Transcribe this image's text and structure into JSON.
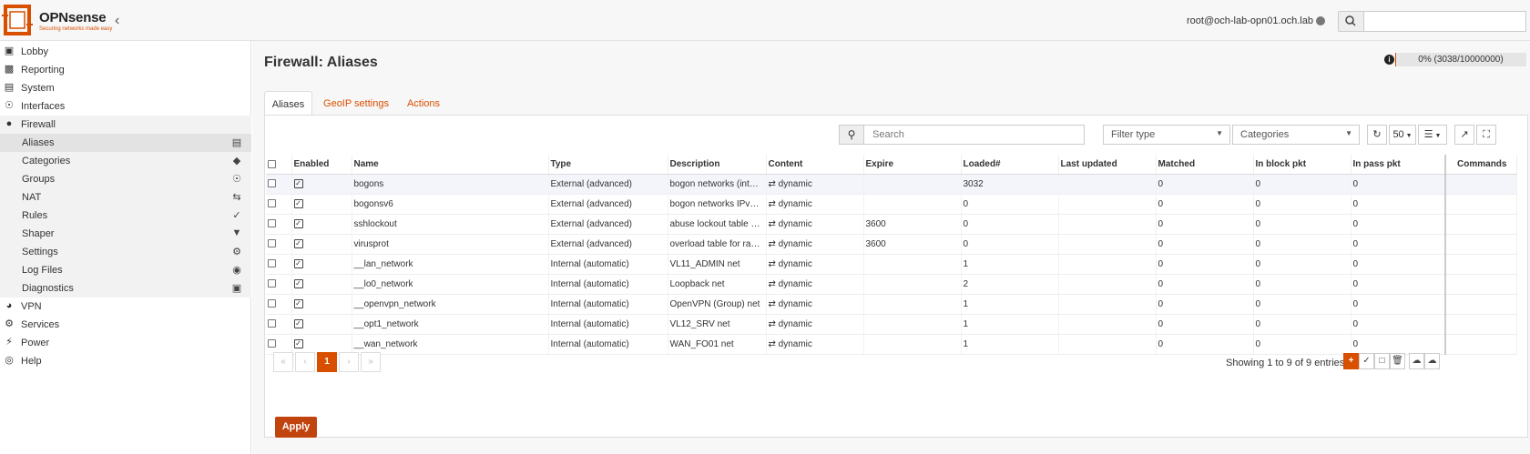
{
  "header": {
    "logo_text": "OPNsense",
    "logo_sub": "Securing networks made easy",
    "user": "root@och-lab-opn01.och.lab"
  },
  "sidebar": {
    "items": [
      {
        "label": "Lobby",
        "icon": "laptop-icon"
      },
      {
        "label": "Reporting",
        "icon": "chart-icon"
      },
      {
        "label": "System",
        "icon": "server-icon"
      },
      {
        "label": "Interfaces",
        "icon": "sitemap-icon"
      },
      {
        "label": "Firewall",
        "icon": "fire-icon"
      },
      {
        "label": "VPN",
        "icon": "globe-icon"
      },
      {
        "label": "Services",
        "icon": "gear-icon"
      },
      {
        "label": "Power",
        "icon": "plug-icon"
      },
      {
        "label": "Help",
        "icon": "lifebuoy-icon"
      }
    ],
    "firewall_sub": [
      {
        "label": "Aliases",
        "icon": "list-alt-icon"
      },
      {
        "label": "Categories",
        "icon": "tags-icon"
      },
      {
        "label": "Groups",
        "icon": "sitemap-icon"
      },
      {
        "label": "NAT",
        "icon": "exchange-icon"
      },
      {
        "label": "Rules",
        "icon": "check-icon"
      },
      {
        "label": "Shaper",
        "icon": "filter-icon"
      },
      {
        "label": "Settings",
        "icon": "cogs-icon"
      },
      {
        "label": "Log Files",
        "icon": "eye-icon"
      },
      {
        "label": "Diagnostics",
        "icon": "medkit-icon"
      }
    ]
  },
  "page": {
    "title": "Firewall: Aliases",
    "usage": "0% (3038/10000000)",
    "usage_fraction": 0.0003
  },
  "tabs": [
    "Aliases",
    "GeoIP settings",
    "Actions"
  ],
  "toolbar": {
    "search_placeholder": "Search",
    "filter_type": "Filter type",
    "categories": "Categories",
    "page_size": "50"
  },
  "table": {
    "headers": [
      "Enabled",
      "Name",
      "Type",
      "Description",
      "Content",
      "Expire",
      "Loaded#",
      "Last updated",
      "Matched",
      "In block pkt",
      "In pass pkt",
      "Commands"
    ],
    "rows": [
      {
        "name": "bogons",
        "type": "External (advanced)",
        "description": "bogon networks (int…",
        "content": "dynamic",
        "expire": "",
        "loaded": "3032",
        "last_updated": "",
        "matched": "0",
        "in_block": "0",
        "in_pass": "0"
      },
      {
        "name": "bogonsv6",
        "type": "External (advanced)",
        "description": "bogon networks IPv…",
        "content": "dynamic",
        "expire": "",
        "loaded": "0",
        "last_updated": "",
        "matched": "0",
        "in_block": "0",
        "in_pass": "0"
      },
      {
        "name": "sshlockout",
        "type": "External (advanced)",
        "description": "abuse lockout table …",
        "content": "dynamic",
        "expire": "3600",
        "loaded": "0",
        "last_updated": "",
        "matched": "0",
        "in_block": "0",
        "in_pass": "0"
      },
      {
        "name": "virusprot",
        "type": "External (advanced)",
        "description": "overload table for ra…",
        "content": "dynamic",
        "expire": "3600",
        "loaded": "0",
        "last_updated": "",
        "matched": "0",
        "in_block": "0",
        "in_pass": "0"
      },
      {
        "name": "__lan_network",
        "type": "Internal (automatic)",
        "description": "VL11_ADMIN net",
        "content": "dynamic",
        "expire": "",
        "loaded": "1",
        "last_updated": "",
        "matched": "0",
        "in_block": "0",
        "in_pass": "0"
      },
      {
        "name": "__lo0_network",
        "type": "Internal (automatic)",
        "description": "Loopback net",
        "content": "dynamic",
        "expire": "",
        "loaded": "2",
        "last_updated": "",
        "matched": "0",
        "in_block": "0",
        "in_pass": "0"
      },
      {
        "name": "__openvpn_network",
        "type": "Internal (automatic)",
        "description": "OpenVPN (Group) net",
        "content": "dynamic",
        "expire": "",
        "loaded": "1",
        "last_updated": "",
        "matched": "0",
        "in_block": "0",
        "in_pass": "0"
      },
      {
        "name": "__opt1_network",
        "type": "Internal (automatic)",
        "description": "VL12_SRV net",
        "content": "dynamic",
        "expire": "",
        "loaded": "1",
        "last_updated": "",
        "matched": "0",
        "in_block": "0",
        "in_pass": "0"
      },
      {
        "name": "__wan_network",
        "type": "Internal (automatic)",
        "description": "WAN_FO01 net",
        "content": "dynamic",
        "expire": "",
        "loaded": "1",
        "last_updated": "",
        "matched": "0",
        "in_block": "0",
        "in_pass": "0"
      }
    ]
  },
  "pager": {
    "current": "1",
    "showing": "Showing 1 to 9 of 9 entries"
  },
  "apply_label": "Apply",
  "colors": {
    "accent": "#d94f00",
    "apply": "#c1440e"
  }
}
